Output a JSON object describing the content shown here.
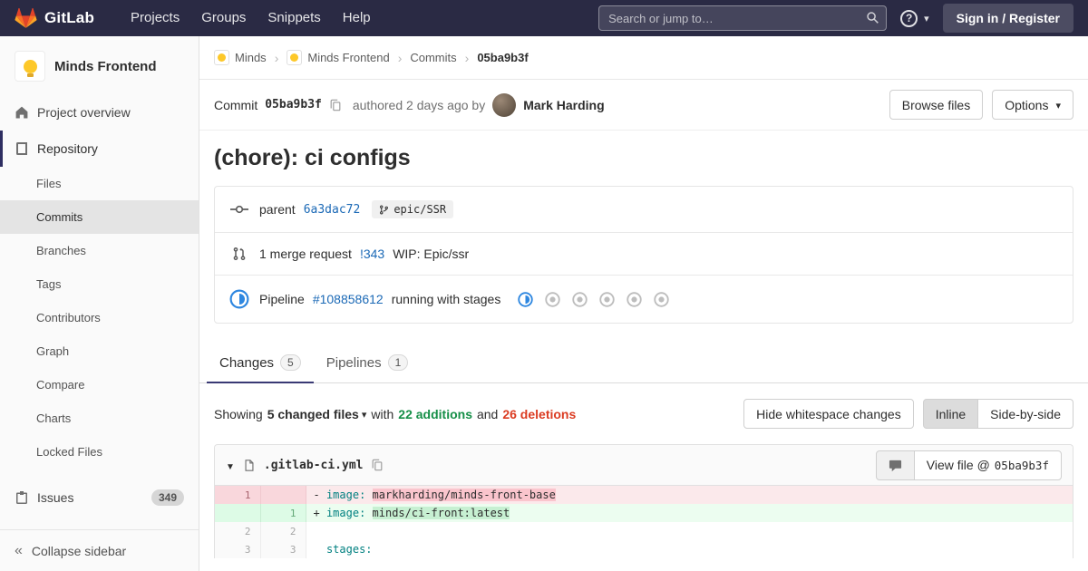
{
  "navbar": {
    "brand": "GitLab",
    "menu": [
      "Projects",
      "Groups",
      "Snippets",
      "Help"
    ],
    "search_placeholder": "Search or jump to…",
    "sign_in": "Sign in / Register"
  },
  "sidebar": {
    "project_name": "Minds Frontend",
    "project_overview": "Project overview",
    "repository": "Repository",
    "repo_items": [
      "Files",
      "Commits",
      "Branches",
      "Tags",
      "Contributors",
      "Graph",
      "Compare",
      "Charts",
      "Locked Files"
    ],
    "issues": "Issues",
    "issues_count": "349",
    "collapse": "Collapse sidebar"
  },
  "breadcrumb": {
    "items": [
      "Minds",
      "Minds Frontend",
      "Commits",
      "05ba9b3f"
    ]
  },
  "commit": {
    "label": "Commit",
    "sha": "05ba9b3f",
    "authored": "authored 2 days ago by",
    "author": "Mark Harding",
    "browse_files": "Browse files",
    "options": "Options",
    "title": "(chore): ci configs"
  },
  "info": {
    "parent_label": "parent",
    "parent_sha": "6a3dac72",
    "branch": "epic/SSR",
    "mr_text": "1 merge request",
    "mr_link": "!343",
    "mr_title": "WIP: Epic/ssr",
    "pipeline_label": "Pipeline",
    "pipeline_link": "#108858612",
    "pipeline_status": "running with stages",
    "pipeline_stages": [
      "running",
      "created",
      "created",
      "created",
      "created",
      "created"
    ]
  },
  "tabs": {
    "changes": "Changes",
    "changes_count": "5",
    "pipelines": "Pipelines",
    "pipelines_count": "1"
  },
  "summary": {
    "showing": "Showing",
    "files": "5 changed files",
    "with": "with",
    "additions": "22 additions",
    "and": "and",
    "deletions": "26 deletions",
    "hide_whitespace": "Hide whitespace changes",
    "inline": "Inline",
    "side_by_side": "Side-by-side"
  },
  "diff": {
    "filename": ".gitlab-ci.yml",
    "view_file": "View file @",
    "view_sha": "05ba9b3f",
    "rows": [
      {
        "old": "1",
        "new": "",
        "prefix": "- ",
        "key": "image: ",
        "highlight": "markharding/minds-front-base"
      },
      {
        "old": "",
        "new": "1",
        "prefix": "+ ",
        "key": "image: ",
        "highlight": "minds/ci-front:latest"
      },
      {
        "old": "2",
        "new": "2",
        "prefix": "",
        "key": "",
        "highlight": ""
      },
      {
        "old": "3",
        "new": "3",
        "prefix": "  ",
        "key": "stages:",
        "highlight": ""
      }
    ]
  },
  "colors": {
    "brand_orange": "#fc6d26",
    "navbar_bg": "#2a2a44",
    "link_blue": "#1b69b6",
    "additions_green": "#168f48",
    "deletions_red": "#db3b21",
    "pipeline_running_blue": "#2e87e0"
  }
}
